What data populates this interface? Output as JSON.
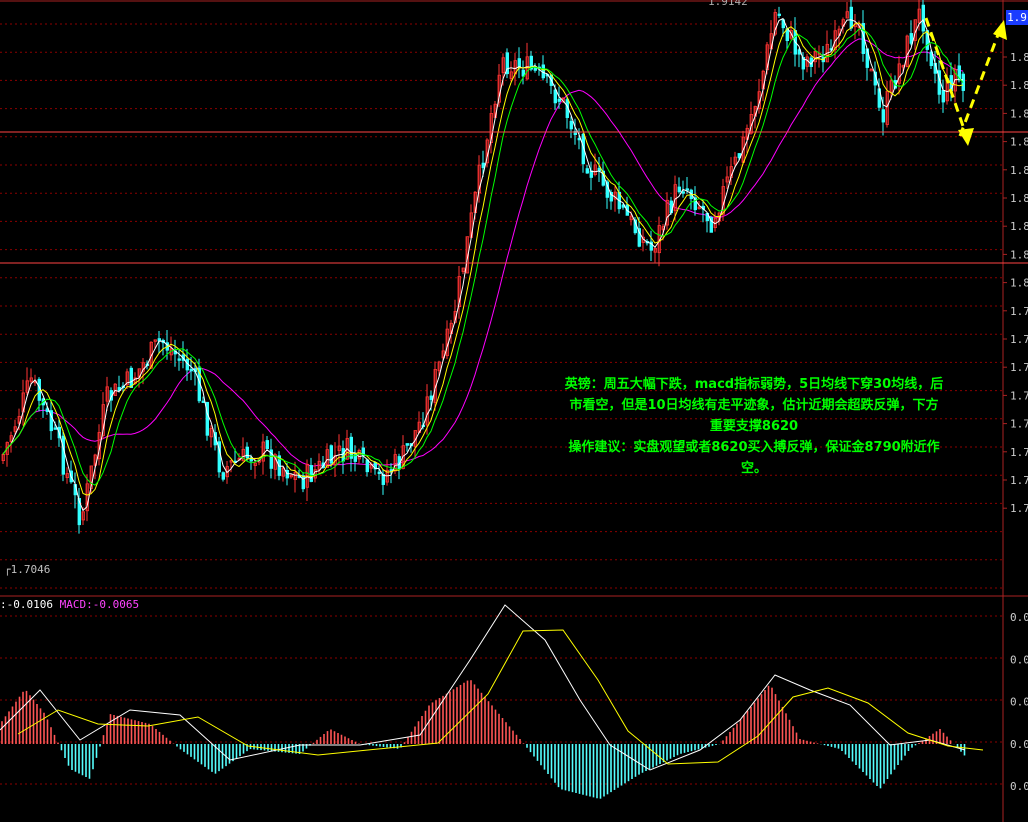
{
  "chart_data": [
    {
      "type": "candlestick",
      "price_label_top": "1.9142",
      "price_label_low": "1.7046",
      "current_price_tag": "1.9",
      "y_axis_ticks": [
        "1.8",
        "1.8",
        "1.8",
        "1.8",
        "1.8",
        "1.8",
        "1.8",
        "1.8",
        "1.8",
        "1.7",
        "1.7",
        "1.7",
        "1.7",
        "1.7",
        "1.7",
        "1.7",
        "1.7"
      ],
      "horizontal_levels": [
        "top",
        "upper-support",
        "lower-support"
      ],
      "moving_averages": [
        {
          "name": "MA5",
          "color": "#ffffff"
        },
        {
          "name": "MA10",
          "color": "#ffff00"
        },
        {
          "name": "MA20",
          "color": "#00ff00"
        },
        {
          "name": "MA30",
          "color": "#ff00ff"
        }
      ],
      "annotation": [
        "英镑：周五大幅下跌，macd指标弱势，5日均线下穿30均线，后",
        "市看空，但是10日均线有走平迹象，估计近期会超跌反弹，下方",
        "重要支撑8620",
        "操作建议：实盘观望或者8620买入搏反弹，保证金8790附近作",
        "空。"
      ],
      "arrows": [
        {
          "direction": "down",
          "color": "#ffff00"
        },
        {
          "direction": "up",
          "color": "#ffff00"
        }
      ]
    },
    {
      "type": "macd",
      "dif_label": ":-0.0106",
      "macd_label": "MACD:-0.0065",
      "y_axis_ticks": [
        "0.0",
        "0.0",
        "0.0",
        "0.0",
        "0.0",
        "-0."
      ],
      "colors": {
        "positive": "#ff5555",
        "negative": "#55ffff",
        "dif": "#ffffff",
        "dea": "#ffff00"
      }
    }
  ]
}
